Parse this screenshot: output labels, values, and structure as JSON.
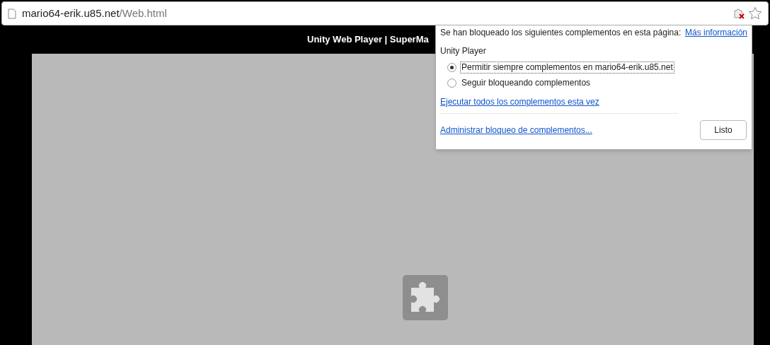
{
  "address_bar": {
    "host": "mario64-erik.u85.net",
    "path": "/Web.html"
  },
  "page_title": "Unity Web Player | SuperMa",
  "popup": {
    "message": "Se han bloqueado los siguientes complementos en esta página:",
    "more_link": "Más información",
    "plugin_name": "Unity Player",
    "options": [
      {
        "label": "Permitir siempre complementos en mario64-erik.u85.net",
        "selected": true
      },
      {
        "label": "Seguir bloqueando complementos",
        "selected": false
      }
    ],
    "run_all_link": "Ejecutar todos los complementos esta vez",
    "manage_link": "Administrar bloqueo de complementos...",
    "done_button": "Listo"
  }
}
